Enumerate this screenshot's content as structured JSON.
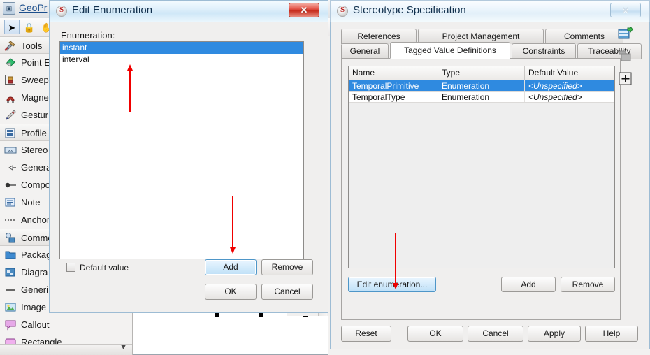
{
  "app": {
    "title": "GeoPr",
    "title_icon": "profile-diagram-icon",
    "toolbar": [
      {
        "name": "select-arrow-tool",
        "glyph": "➤",
        "selected": true
      },
      {
        "name": "lock-tool",
        "glyph": "🔒",
        "selected": false
      },
      {
        "name": "pan-hand-tool",
        "glyph": "✋",
        "selected": false
      }
    ]
  },
  "palette": {
    "items": [
      {
        "label": "Tools",
        "icon": "tools-hammer-icon",
        "group": true
      },
      {
        "label": "Point E",
        "icon": "point-eraser-icon",
        "group": false
      },
      {
        "label": "Sweep",
        "icon": "sweep-brush-icon",
        "group": false
      },
      {
        "label": "Magne",
        "icon": "magnet-icon",
        "group": false
      },
      {
        "label": "Gestur",
        "icon": "gesture-pen-icon",
        "group": false
      },
      {
        "label": "Profile",
        "icon": "profile-icon",
        "group": true
      },
      {
        "label": "Stereo",
        "icon": "stereotype-icon",
        "group": false
      },
      {
        "label": "Genera",
        "icon": "generalization-icon",
        "group": false
      },
      {
        "label": "Compo",
        "icon": "composition-icon",
        "group": false
      },
      {
        "label": "Note",
        "icon": "note-icon",
        "group": false
      },
      {
        "label": "Anchor",
        "icon": "anchor-dotted-icon",
        "group": false
      },
      {
        "label": "Commo",
        "icon": "common-icon",
        "group": true
      },
      {
        "label": "Packag",
        "icon": "package-folder-icon",
        "group": false
      },
      {
        "label": "Diagra",
        "icon": "diagram-icon",
        "group": false
      },
      {
        "label": "Generi",
        "icon": "generic-line-icon",
        "group": false
      },
      {
        "label": "Image",
        "icon": "image-icon",
        "group": false
      },
      {
        "label": "Callout",
        "icon": "callout-icon",
        "group": false
      },
      {
        "label": "Rectangle",
        "icon": "rectangle-icon",
        "group": false
      }
    ],
    "scroll_down_icon": "chevron-down-icon"
  },
  "mid_panel": {
    "move_up_icon": "chevron-up-icon",
    "move_down_icon": "chevron-down-icon"
  },
  "edit_enumeration_dialog": {
    "title": "Edit Enumeration",
    "icon": "magicdraw-icon",
    "close_label": "✕",
    "list_label": "Enumeration:",
    "items": [
      {
        "value": "instant",
        "selected": true
      },
      {
        "value": "interval",
        "selected": false
      }
    ],
    "default_value_label": "Default value",
    "default_value_checked": false,
    "buttons": {
      "add": "Add",
      "remove": "Remove",
      "ok": "OK",
      "cancel": "Cancel"
    }
  },
  "stereotype_dialog": {
    "title": "Stereotype Specification",
    "icon": "magicdraw-icon",
    "close_label": "✕",
    "tabs_top": [
      {
        "label": "References",
        "active": false
      },
      {
        "label": "Project Management",
        "active": false
      },
      {
        "label": "Comments",
        "active": false
      }
    ],
    "tabs_bottom": [
      {
        "label": "General",
        "active": false
      },
      {
        "label": "Tagged Value Definitions",
        "active": true
      },
      {
        "label": "Constraints",
        "active": false
      },
      {
        "label": "Traceability",
        "active": false
      }
    ],
    "table": {
      "columns": [
        "Name",
        "Type",
        "Default Value"
      ],
      "rows": [
        {
          "name": "TemporalPrimitive",
          "type": "Enumeration",
          "default_value": "<Unspecified>",
          "selected": true
        },
        {
          "name": "TemporalType",
          "type": "Enumeration",
          "default_value": "<Unspecified>",
          "selected": false
        }
      ]
    },
    "panel_buttons": {
      "edit_enumeration": "Edit enumeration...",
      "add": "Add",
      "remove": "Remove"
    },
    "footer_buttons": {
      "reset": "Reset",
      "ok": "OK",
      "cancel": "Cancel",
      "apply": "Apply",
      "help": "Help"
    },
    "side_icons": [
      {
        "name": "add-table-icon"
      },
      {
        "name": "gray-table-icon"
      },
      {
        "name": "expand-plus-icon"
      }
    ]
  },
  "annotations": {
    "arrow_color": "#f00000",
    "arrows": [
      {
        "name": "arrow-to-enumeration-list",
        "direction": "up"
      },
      {
        "name": "arrow-to-add-button",
        "direction": "down"
      },
      {
        "name": "arrow-to-edit-enumeration-button",
        "direction": "down"
      }
    ]
  }
}
